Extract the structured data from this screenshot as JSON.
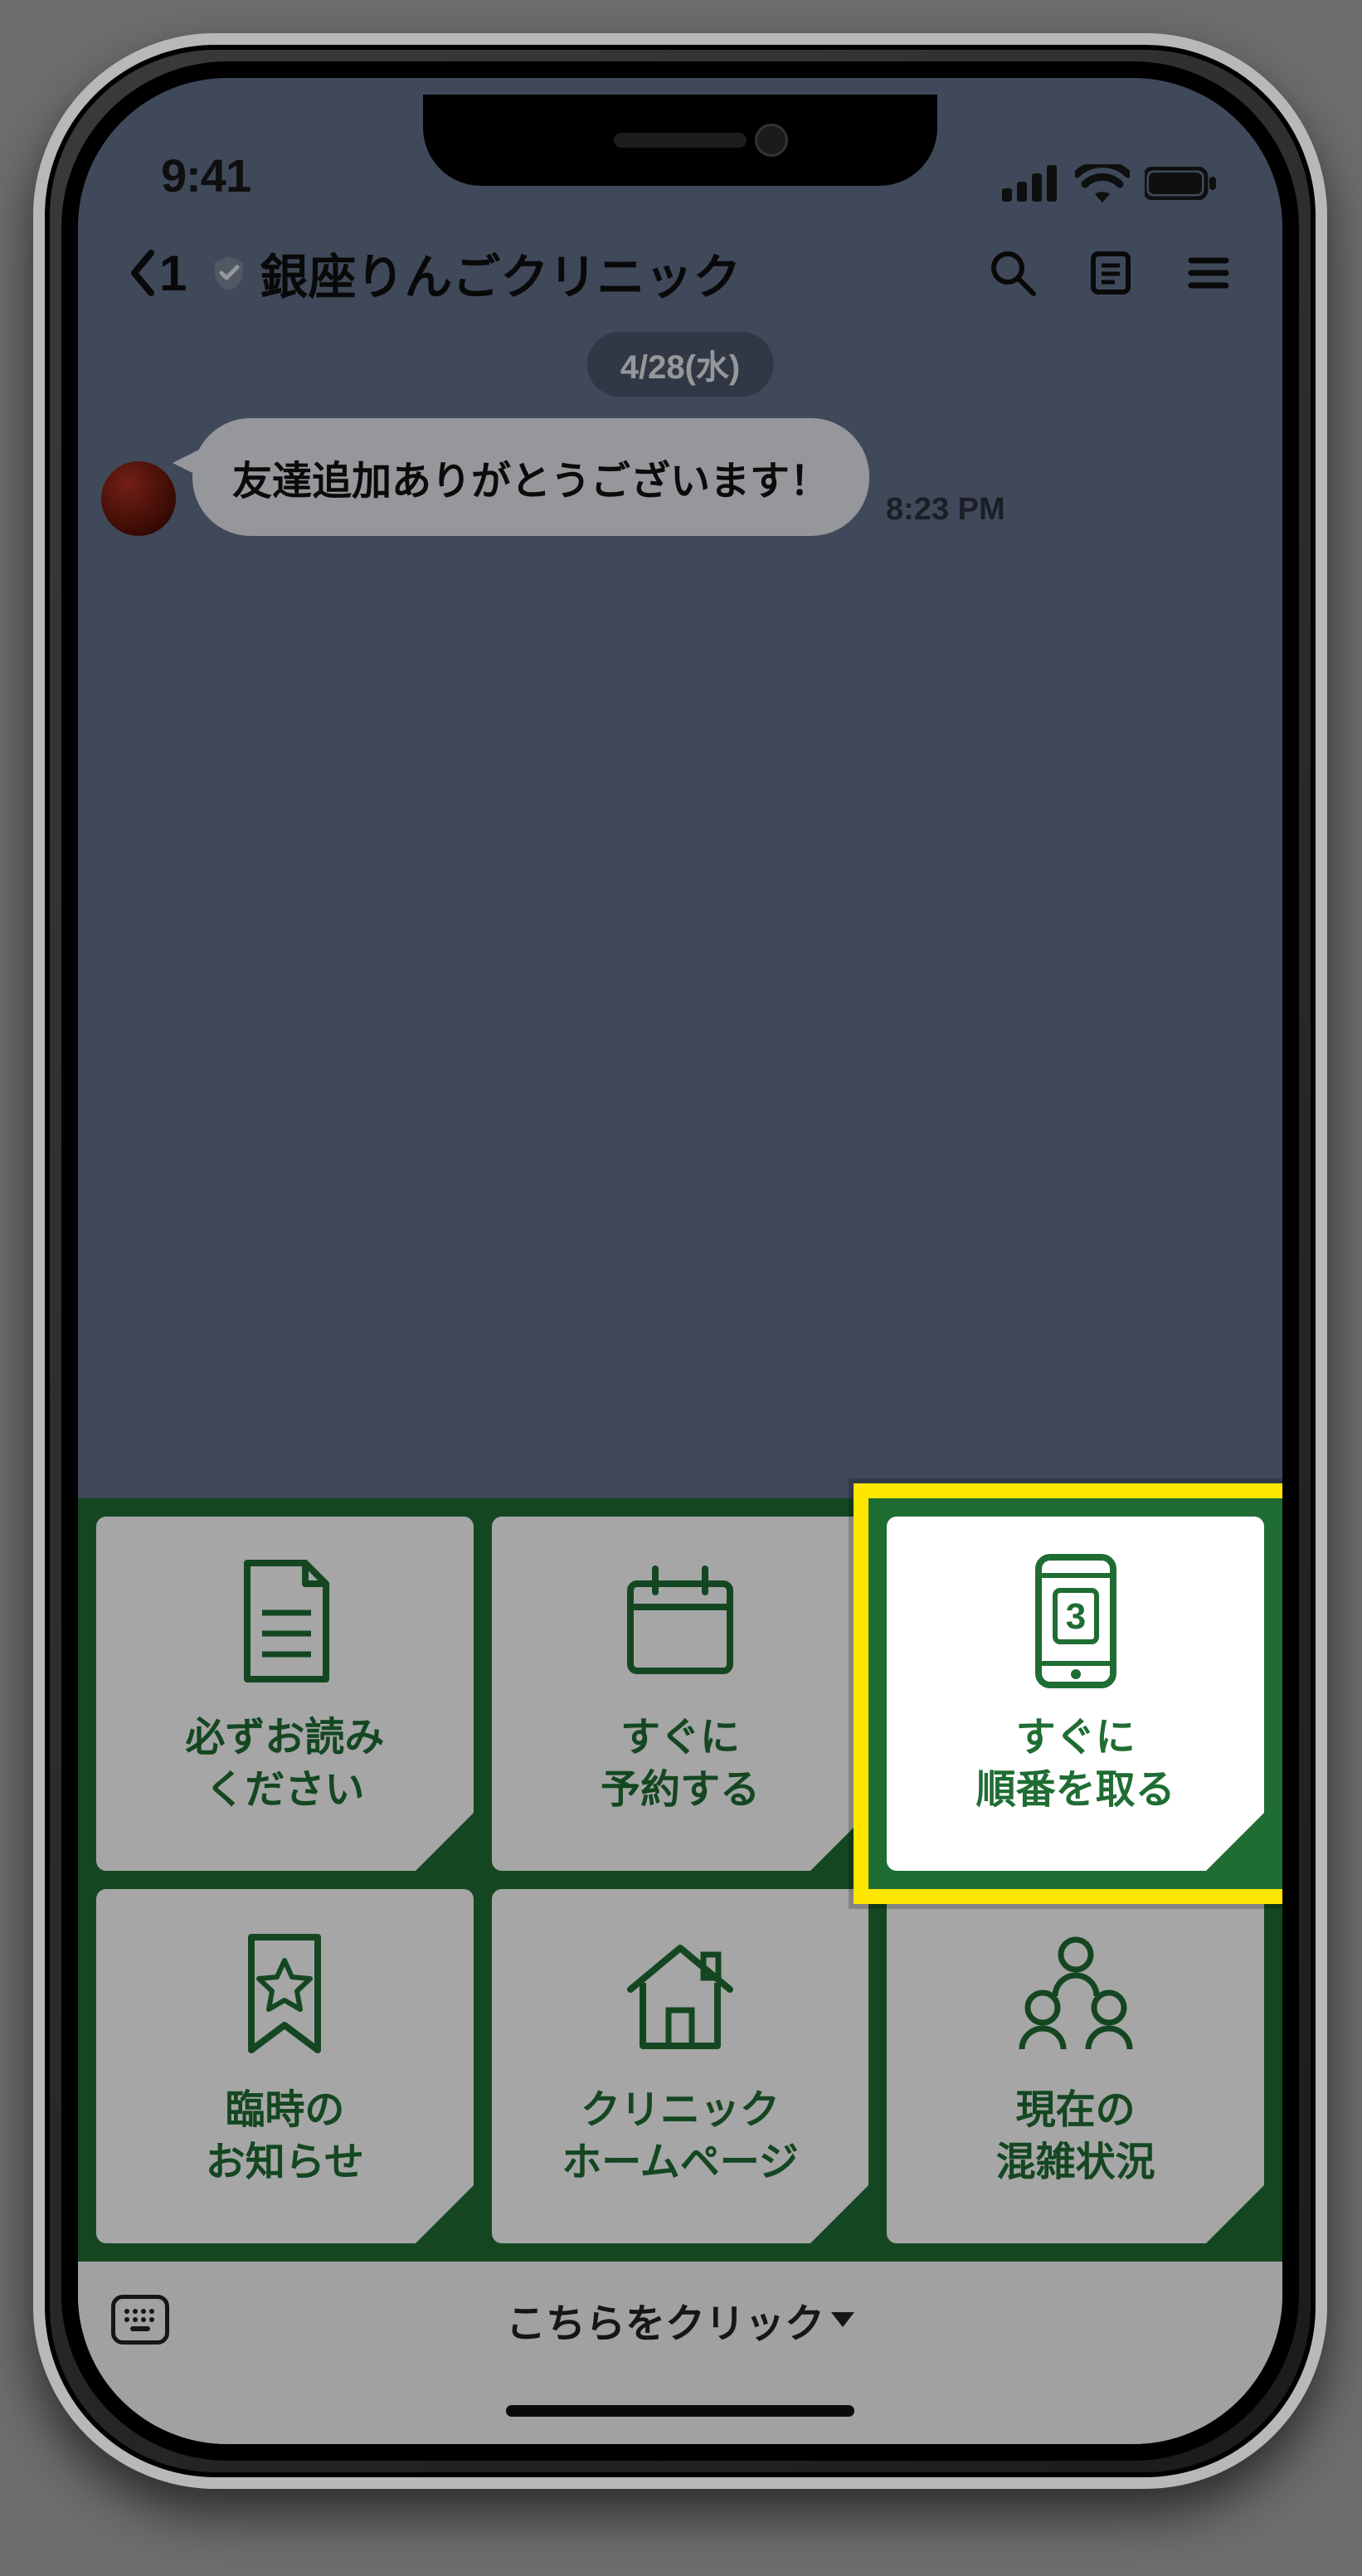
{
  "statusbar": {
    "time": "9:41"
  },
  "header": {
    "back_count": "1",
    "account_name": "銀座りんごクリニック"
  },
  "chat": {
    "date_badge": "4/28(水)",
    "messages": [
      {
        "text": "友達追加ありがとうございます！",
        "time": "8:23 PM"
      }
    ]
  },
  "rich_menu": {
    "tiles": [
      {
        "id": "read-first",
        "line1": "必ずお読み",
        "line2": "ください"
      },
      {
        "id": "reserve",
        "line1": "すぐに",
        "line2": "予約する"
      },
      {
        "id": "take-number",
        "line1": "すぐに",
        "line2": "順番を取る",
        "ticket_number": "3"
      },
      {
        "id": "news",
        "line1": "臨時の",
        "line2": "お知らせ"
      },
      {
        "id": "homepage",
        "line1": "クリニック",
        "line2": "ホームページ"
      },
      {
        "id": "congestion",
        "line1": "現在の",
        "line2": "混雑状況"
      }
    ]
  },
  "footer": {
    "label": "こちらをクリック"
  },
  "highlight": {
    "tile_index": 2
  },
  "colors": {
    "brand_green": "#1f6d33",
    "highlight_yellow": "#ffe600"
  }
}
